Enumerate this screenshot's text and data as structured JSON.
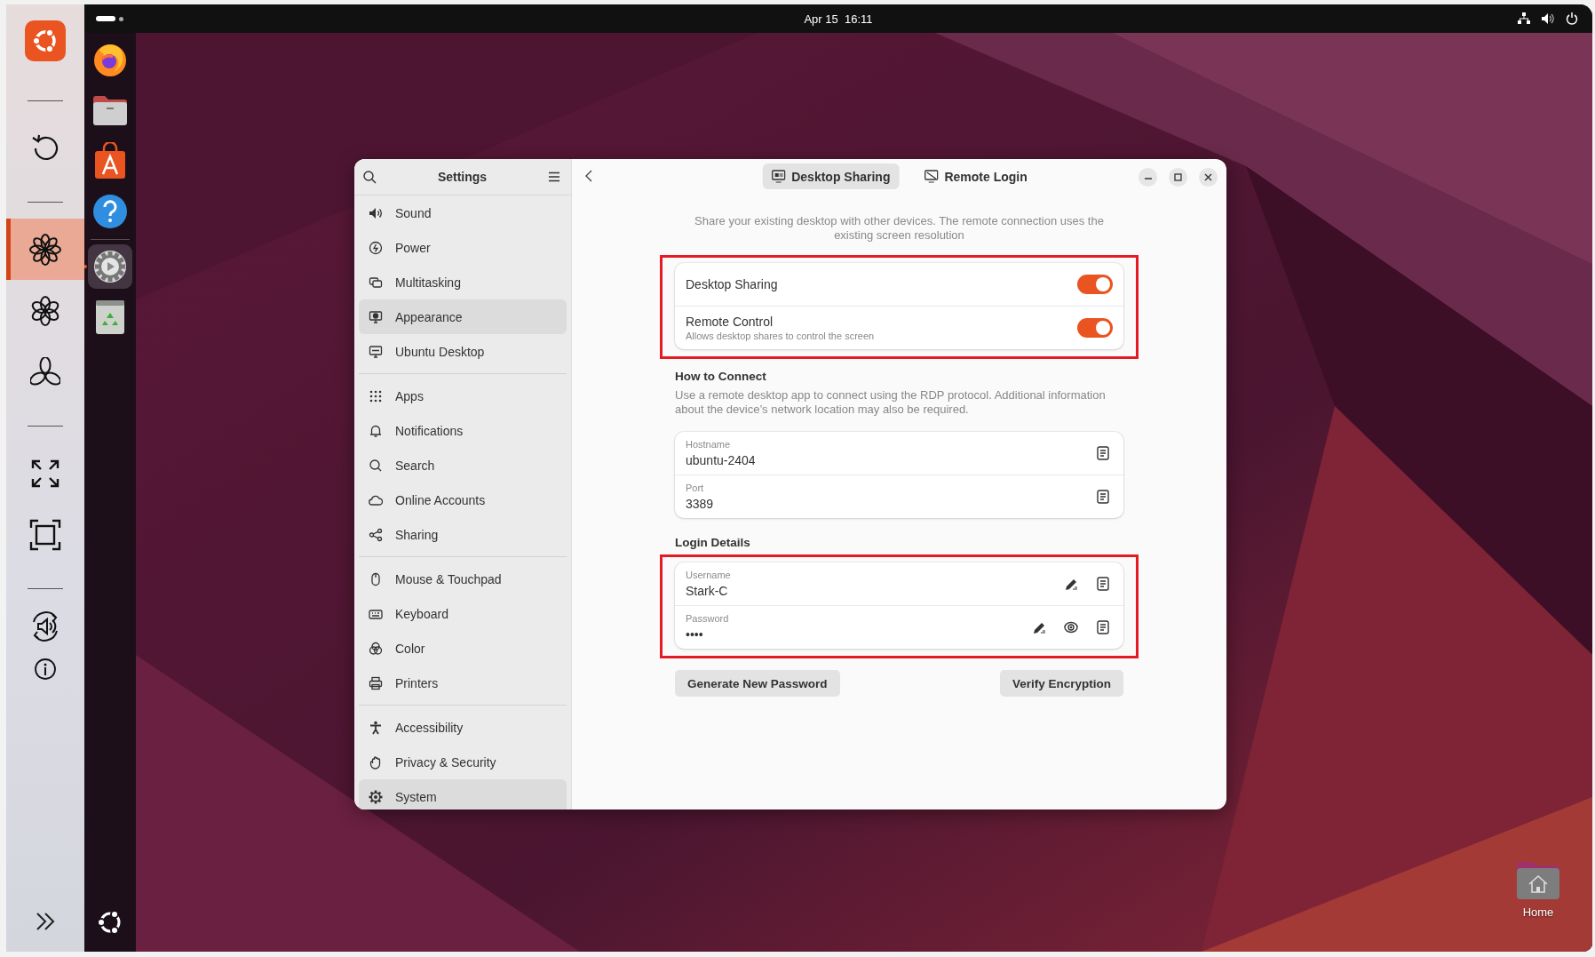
{
  "top_bar": {
    "clock": "Apr 15  16:11"
  },
  "side_panel": {
    "groups": [
      [
        {
          "selected": false
        }
      ],
      [
        {
          "selected": false
        }
      ],
      [
        {
          "selected": true
        },
        {
          "selected": false
        },
        {
          "selected": false
        }
      ],
      [
        {
          "selected": false
        },
        {
          "selected": false
        }
      ],
      [
        {
          "selected": false
        },
        {
          "selected": false
        }
      ]
    ]
  },
  "dock": {
    "apps": [
      {
        "running": false
      },
      {
        "running": false
      },
      {
        "running": false
      },
      {
        "running": false
      },
      {
        "running": true
      },
      {
        "running": false
      }
    ]
  },
  "settings": {
    "title": "Settings",
    "sidebar": {
      "groups": [
        [
          {
            "label": "Sound",
            "selected": false
          },
          {
            "label": "Power",
            "selected": false
          },
          {
            "label": "Multitasking",
            "selected": false
          },
          {
            "label": "Appearance",
            "selected": true
          },
          {
            "label": "Ubuntu Desktop",
            "selected": false
          }
        ],
        [
          {
            "label": "Apps",
            "selected": false
          },
          {
            "label": "Notifications",
            "selected": false
          },
          {
            "label": "Search",
            "selected": false
          },
          {
            "label": "Online Accounts",
            "selected": false
          },
          {
            "label": "Sharing",
            "selected": false
          }
        ],
        [
          {
            "label": "Mouse & Touchpad",
            "selected": false
          },
          {
            "label": "Keyboard",
            "selected": false
          },
          {
            "label": "Color",
            "selected": false
          },
          {
            "label": "Printers",
            "selected": false
          }
        ],
        [
          {
            "label": "Accessibility",
            "selected": false
          },
          {
            "label": "Privacy & Security",
            "selected": false
          },
          {
            "label": "System",
            "selected": true
          }
        ]
      ]
    },
    "tabs": [
      {
        "label": "Desktop Sharing",
        "selected": true
      },
      {
        "label": "Remote Login",
        "selected": false
      }
    ],
    "description": "Share your existing desktop with other devices. The remote connection uses the existing screen resolution",
    "sharing": {
      "annotated": true,
      "rows": [
        {
          "label": "Desktop Sharing",
          "on": true
        },
        {
          "label": "Remote Control",
          "subtitle": "Allows desktop shares to control the screen",
          "on": true
        }
      ]
    },
    "how_to_connect": {
      "heading": "How to Connect",
      "description": "Use a remote desktop app to connect using the RDP protocol. Additional information about the device’s network location may also be required.",
      "annotated": false,
      "rows": [
        {
          "label": "Hostname",
          "value": "ubuntu-2404",
          "editable": false,
          "revealable": false
        },
        {
          "label": "Port",
          "value": "3389",
          "editable": false,
          "revealable": false
        }
      ]
    },
    "login_details": {
      "heading": "Login Details",
      "annotated": true,
      "rows": [
        {
          "label": "Username",
          "value": "Stark-C",
          "editable": true,
          "revealable": false
        },
        {
          "label": "Password",
          "value": "••••",
          "editable": true,
          "revealable": true
        }
      ]
    },
    "buttons": [
      "Generate New Password",
      "Verify Encryption"
    ]
  },
  "desktop": {
    "home_label": "Home"
  }
}
